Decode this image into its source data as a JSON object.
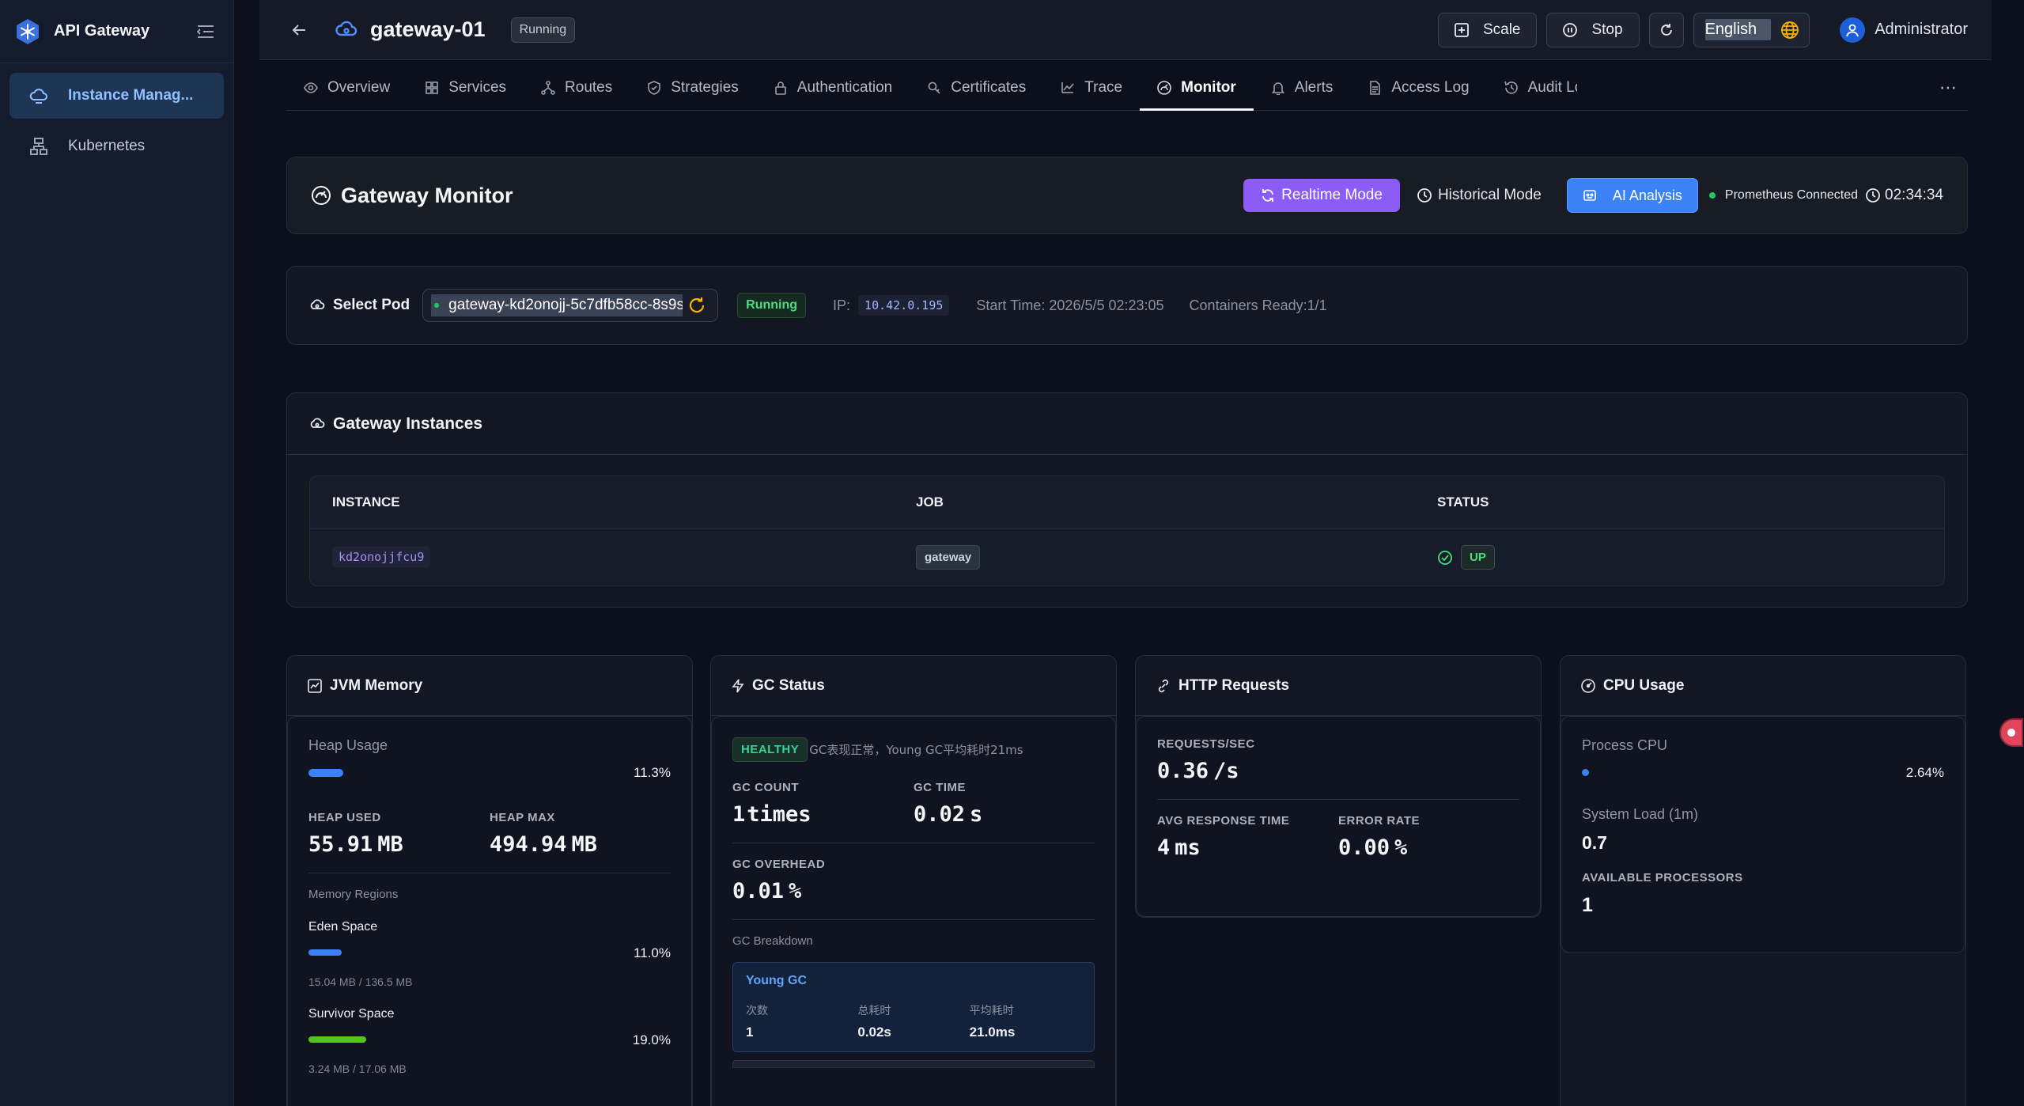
{
  "sidebar": {
    "title": "API Gateway",
    "items": [
      {
        "label": "Instance Manag...",
        "active": true
      },
      {
        "label": "Kubernetes",
        "active": false
      }
    ]
  },
  "header": {
    "gateway_name": "gateway-01",
    "status": "Running",
    "scale_label": "Scale",
    "stop_label": "Stop",
    "language": "English",
    "user": "Administrator"
  },
  "tabs": [
    {
      "label": "Overview",
      "icon": "eye-icon"
    },
    {
      "label": "Services",
      "icon": "grid-icon"
    },
    {
      "label": "Routes",
      "icon": "routes-icon"
    },
    {
      "label": "Strategies",
      "icon": "shield-icon"
    },
    {
      "label": "Authentication",
      "icon": "lock-icon"
    },
    {
      "label": "Certificates",
      "icon": "key-icon"
    },
    {
      "label": "Trace",
      "icon": "trend-icon"
    },
    {
      "label": "Monitor",
      "icon": "gauge-icon",
      "active": true
    },
    {
      "label": "Alerts",
      "icon": "bell-icon"
    },
    {
      "label": "Access Log",
      "icon": "file-icon"
    },
    {
      "label": "Audit Log",
      "icon": "history-icon"
    }
  ],
  "monitor": {
    "title": "Gateway Monitor",
    "realtime_label": "Realtime Mode",
    "historical_label": "Historical Mode",
    "ai_label": "AI Analysis",
    "prometheus": "Prometheus Connected",
    "clock": "02:34:34"
  },
  "pod": {
    "label": "Select Pod",
    "selected": "gateway-kd2onojj-5c7dfb58cc-8s9s",
    "status": "Running",
    "ip_label": "IP:",
    "ip": "10.42.0.195",
    "start_time": "Start Time: 2026/5/5 02:23:05",
    "containers": "Containers Ready:1/1"
  },
  "instances": {
    "title": "Gateway Instances",
    "columns": [
      "INSTANCE",
      "JOB",
      "STATUS"
    ],
    "rows": [
      {
        "instance": "kd2onojjfcu9",
        "job": "gateway",
        "status": "UP"
      }
    ]
  },
  "jvm": {
    "title": "JVM Memory",
    "heap_usage_label": "Heap Usage",
    "heap_usage_pct": "11.3%",
    "heap_usage_value": 0.113,
    "heap_used_label": "HEAP USED",
    "heap_used": "55.91",
    "heap_used_unit": "MB",
    "heap_max_label": "HEAP MAX",
    "heap_max": "494.94",
    "heap_max_unit": "MB",
    "regions_label": "Memory Regions",
    "regions": [
      {
        "name": "Eden Space",
        "pct": "11.0%",
        "value": 0.11,
        "size": "15.04 MB / 136.5 MB",
        "color": "#3b82f6"
      },
      {
        "name": "Survivor Space",
        "pct": "19.0%",
        "value": 0.19,
        "size": "3.24 MB / 17.06 MB",
        "color": "#52c41a"
      }
    ]
  },
  "gc": {
    "title": "GC Status",
    "health": "HEALTHY",
    "note": "GC表现正常，Young GC平均耗时21ms",
    "count_label": "GC COUNT",
    "count": "1",
    "count_unit": "times",
    "time_label": "GC TIME",
    "time": "0.02",
    "time_unit": "s",
    "overhead_label": "GC OVERHEAD",
    "overhead": "0.01",
    "overhead_unit": "%",
    "breakdown_label": "GC Breakdown",
    "young": {
      "title": "Young GC",
      "k1": "次数",
      "v1": "1",
      "k2": "总耗时",
      "v2": "0.02s",
      "k3": "平均耗时",
      "v3": "21.0ms"
    }
  },
  "http": {
    "title": "HTTP Requests",
    "rps_label": "REQUESTS/SEC",
    "rps": "0.36",
    "rps_unit": "/s",
    "avg_label": "AVG RESPONSE TIME",
    "avg": "4",
    "avg_unit": "ms",
    "err_label": "ERROR RATE",
    "err": "0.00",
    "err_unit": "%"
  },
  "cpu": {
    "title": "CPU Usage",
    "process_label": "Process CPU",
    "process_pct": "2.64%",
    "process_value": 0.0264,
    "load_label": "System Load (1m)",
    "load": "0.7",
    "proc_label": "AVAILABLE PROCESSORS",
    "processors": "1"
  },
  "colors": {
    "accent_purple": "#8b5cf6",
    "accent_blue": "#3b82f6",
    "success": "#22c55e"
  }
}
